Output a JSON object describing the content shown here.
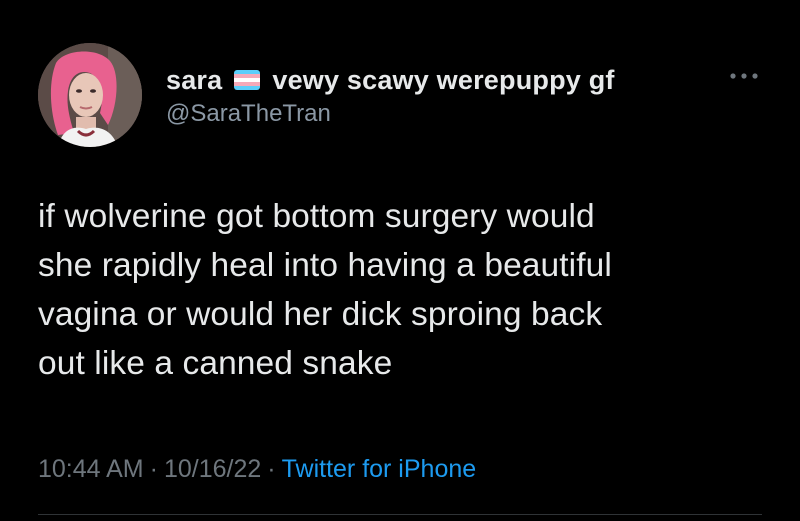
{
  "tweet": {
    "author": {
      "display_name": "sara",
      "flag_icon": "transgender-flag-icon",
      "name_suffix": "vewy scawy werepuppy gf",
      "handle": "@SaraTheTran",
      "avatar": "profile-photo"
    },
    "more_icon": "more-horizontal-icon",
    "text": "if wolverine got bottom surgery would\nshe rapidly heal into having a beautiful\nvagina or would her dick sproing back\nout like a canned snake",
    "time": "10:44 AM",
    "date": "10/16/22",
    "separator": "·",
    "source": "Twitter for iPhone"
  },
  "colors": {
    "background": "#000000",
    "primary_text": "#e7e9ea",
    "secondary_text": "#8b98a5",
    "link": "#1d9bf0",
    "flag_blue": "#5bcefa",
    "flag_pink": "#f5a9b8",
    "flag_white": "#ffffff"
  }
}
